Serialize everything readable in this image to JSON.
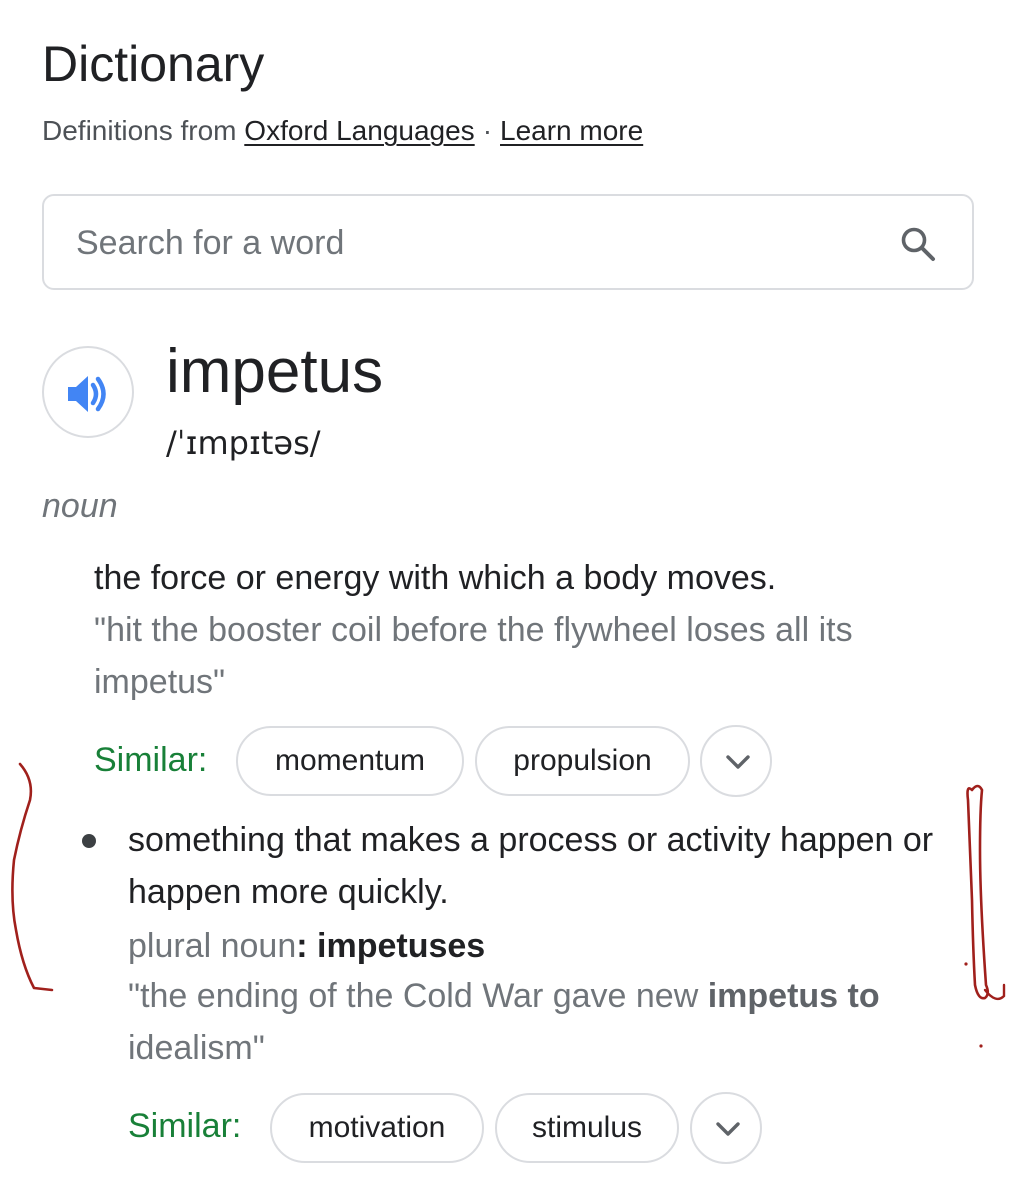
{
  "header": {
    "title": "Dictionary",
    "attribution_prefix": "Definitions from",
    "source_link": "Oxford Languages",
    "separator": "·",
    "learn_more": "Learn more"
  },
  "search": {
    "placeholder": "Search for a word",
    "value": ""
  },
  "entry": {
    "word": "impetus",
    "phonetic": "/ˈɪmpɪtəs/",
    "part_of_speech": "noun",
    "senses": [
      {
        "definition": "the force or energy with which a body moves.",
        "example": "\"hit the booster coil before the flywheel loses all its impetus\"",
        "similar_label": "Similar:",
        "similar": [
          "momentum",
          "propulsion"
        ]
      },
      {
        "definition": "something that makes a process or activity happen or happen more quickly.",
        "plural_label": "plural noun",
        "plural_colon": ":",
        "plural_form": "impetuses",
        "example_start": "\"the ending of the Cold War gave new ",
        "example_bold": "impetus to",
        "example_end": " idealism\"",
        "similar_label": "Similar:",
        "similar": [
          "motivation",
          "stimulus"
        ]
      }
    ]
  },
  "icons": {
    "search": "search-icon",
    "audio": "speaker-icon",
    "expand": "chevron-down-icon"
  },
  "colors": {
    "similar_label": "#188038",
    "audio_icon": "#4285f4",
    "annotation_ink": "#a0201c"
  }
}
